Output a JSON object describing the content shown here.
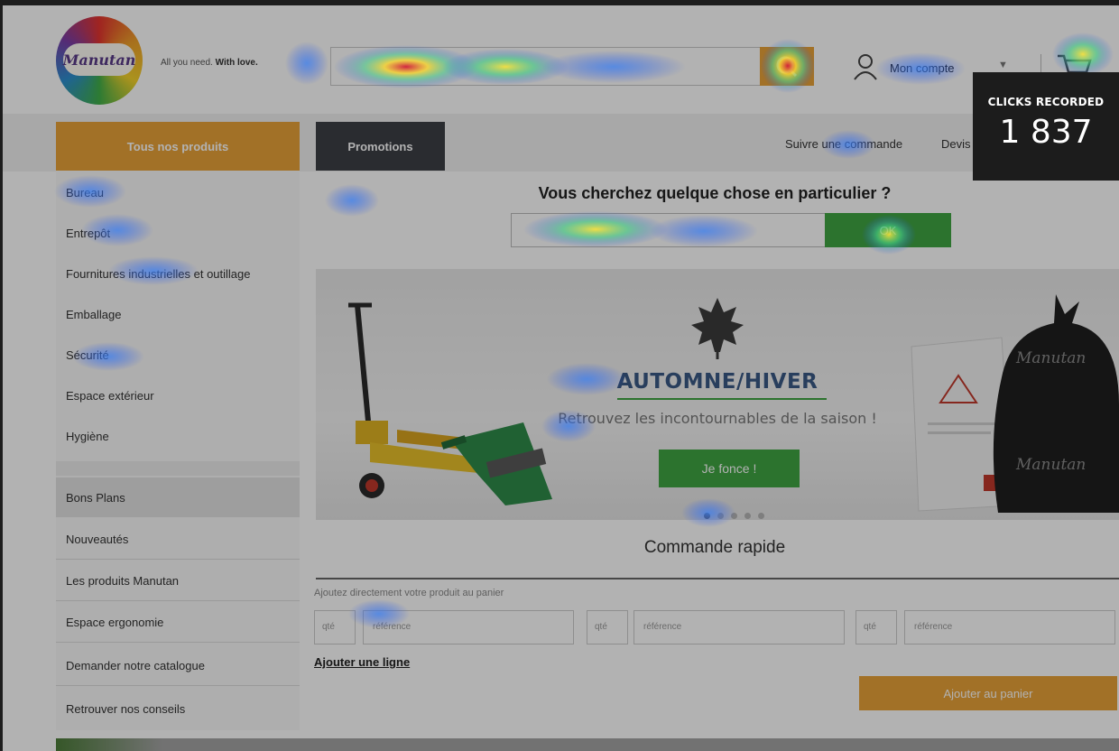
{
  "header": {
    "logo_text": "Manutan",
    "tagline_plain": "All you need.",
    "tagline_bold": "With love.",
    "account_label": "Mon compte"
  },
  "nav": {
    "all_products": "Tous nos produits",
    "promotions": "Promotions",
    "links": [
      "Suivre une commande",
      "Devis rapide"
    ]
  },
  "sidebar": {
    "categories": [
      "Bureau",
      "Entrepôt",
      "Fournitures industrielles et outillage",
      "Emballage",
      "Sécurité",
      "Espace extérieur",
      "Hygiène"
    ],
    "extras": [
      "Bons Plans",
      "Nouveautés",
      "Les produits Manutan",
      "Espace ergonomie",
      "Demander notre catalogue",
      "Retrouver nos conseils"
    ]
  },
  "search": {
    "title": "Vous cherchez quelque chose en particulier ?",
    "button": "OK"
  },
  "banner": {
    "title": "AUTOMNE/HIVER",
    "subtitle": "Retrouvez les incontournables de la saison !",
    "cta": "Je fonce !",
    "bag_brand": "Manutan"
  },
  "quick_order": {
    "title": "Commande rapide",
    "hint": "Ajoutez directement votre produit au panier",
    "qty_placeholder": "qté",
    "ref_placeholder": "référence",
    "add_line": "Ajouter une ligne",
    "add_to_cart": "Ajouter au panier"
  },
  "overlay": {
    "clicks_label": "CLICKS RECORDED",
    "clicks_count": "1 837"
  },
  "colors": {
    "accent_orange": "#e9a338",
    "accent_green": "#3fa543",
    "dark_tab": "#3d4046",
    "banner_title": "#3a5a86"
  }
}
